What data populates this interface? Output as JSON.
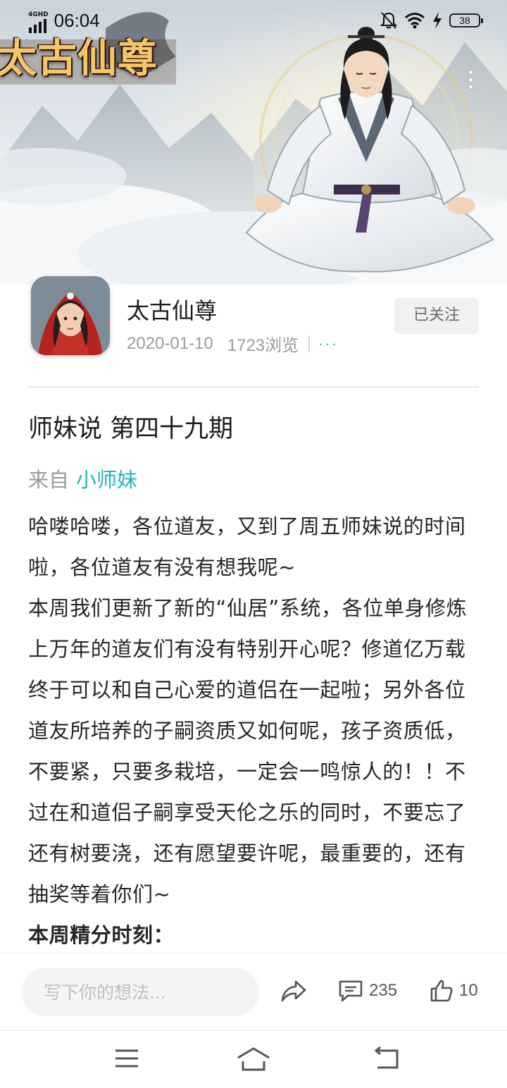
{
  "status_bar": {
    "network": "4GHD",
    "time": "06:04",
    "battery": "38"
  },
  "hero": {
    "game_logo": "太古仙尊"
  },
  "author": {
    "name": "太古仙尊",
    "date": "2020-01-10",
    "views": "1723浏览",
    "more": "···",
    "follow_label": "已关注"
  },
  "article": {
    "title": "师妹说 第四十九期",
    "source_prefix": "来自",
    "source_name": "小师妹",
    "paragraphs": [
      "哈喽哈喽，各位道友，又到了周五师妹说的时间啦，各位道友有没有想我呢~",
      "本周我们更新了新的“仙居”系统，各位单身修炼上万年的道友们有没有特别开心呢？修道亿万载终于可以和自己心爱的道侣在一起啦；另外各位道友所培养的子嗣资质又如何呢，孩子资质低，不要紧，只要多栽培，一定会一鸣惊人的！！不过在和道侣子嗣享受天伦之乐的同时，不要忘了还有树要浇，还有愿望要许呢，最重要的，还有抽奖等着你们~"
    ],
    "section_heading": "本周精分时刻："
  },
  "action_bar": {
    "comment_placeholder": "写下你的想法...",
    "comment_count": "235",
    "like_count": "10"
  },
  "icons": {
    "share": "share-icon",
    "comment": "comment-icon",
    "like": "thumbs-up-icon",
    "menu": "menu-icon",
    "home": "home-icon",
    "back": "back-icon"
  },
  "colors": {
    "accent": "#26b2bd",
    "follow_bg": "#f1f1f1",
    "muted_text": "#9b9b9b"
  }
}
